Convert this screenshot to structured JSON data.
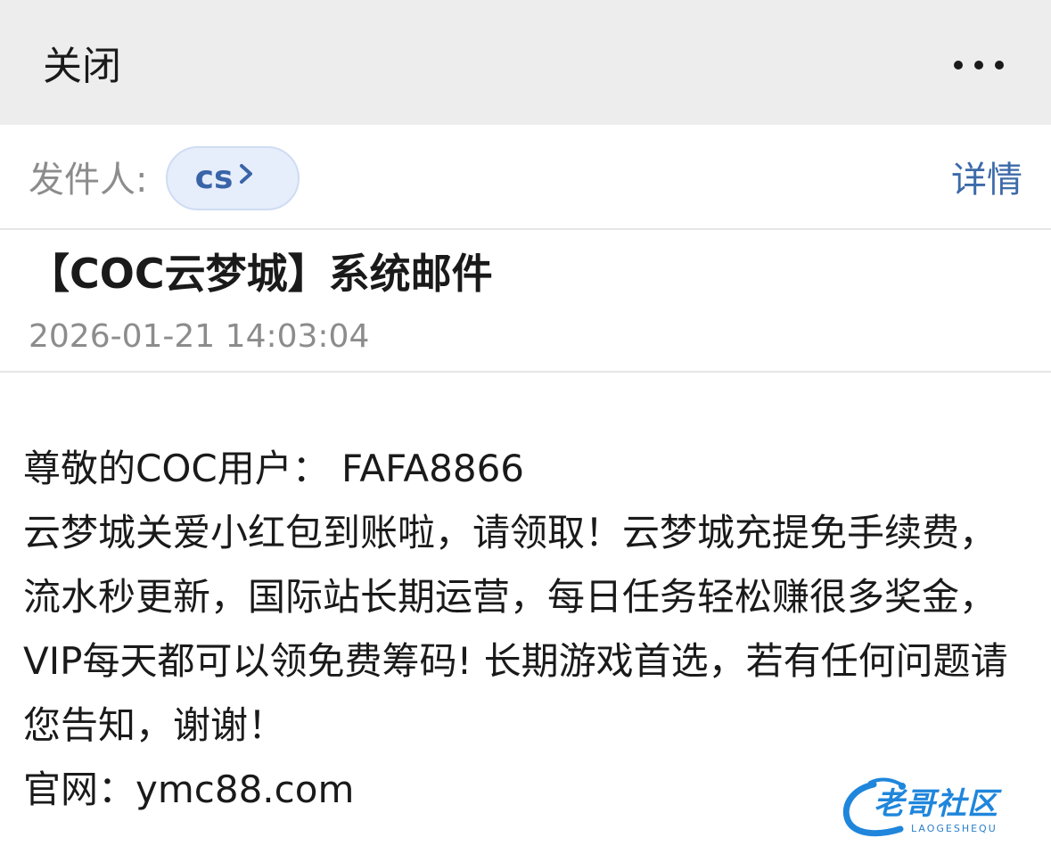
{
  "topbar": {
    "close_label": "关闭",
    "more_icon": "more-horizontal-icon"
  },
  "sender": {
    "label": "发件人:",
    "name": "cs",
    "chevron_icon": "chevron-right-icon",
    "detail_label": "详情"
  },
  "message": {
    "subject": "【COC云梦城】系统邮件",
    "timestamp": "2026-01-21 14:03:04",
    "greeting": "尊敬的COC用户： FAFA8866",
    "paragraph": "云梦城关爱小红包到账啦，请领取！云梦城充提免手续费，流水秒更新，国际站长期运营，每日任务轻松赚很多奖金，VIP每天都可以领免费筹码! 长期游戏首选，若有任何问题请您告知，谢谢！",
    "website": "官网：ymc88.com"
  },
  "watermark": {
    "logo_text": "老哥社区",
    "sub_text": "LAOGESHEQU"
  },
  "colors": {
    "topbar_bg": "#ededed",
    "link_blue": "#3d6aa9",
    "chip_bg": "#e6eefb",
    "muted_text": "#8c8c8c"
  }
}
